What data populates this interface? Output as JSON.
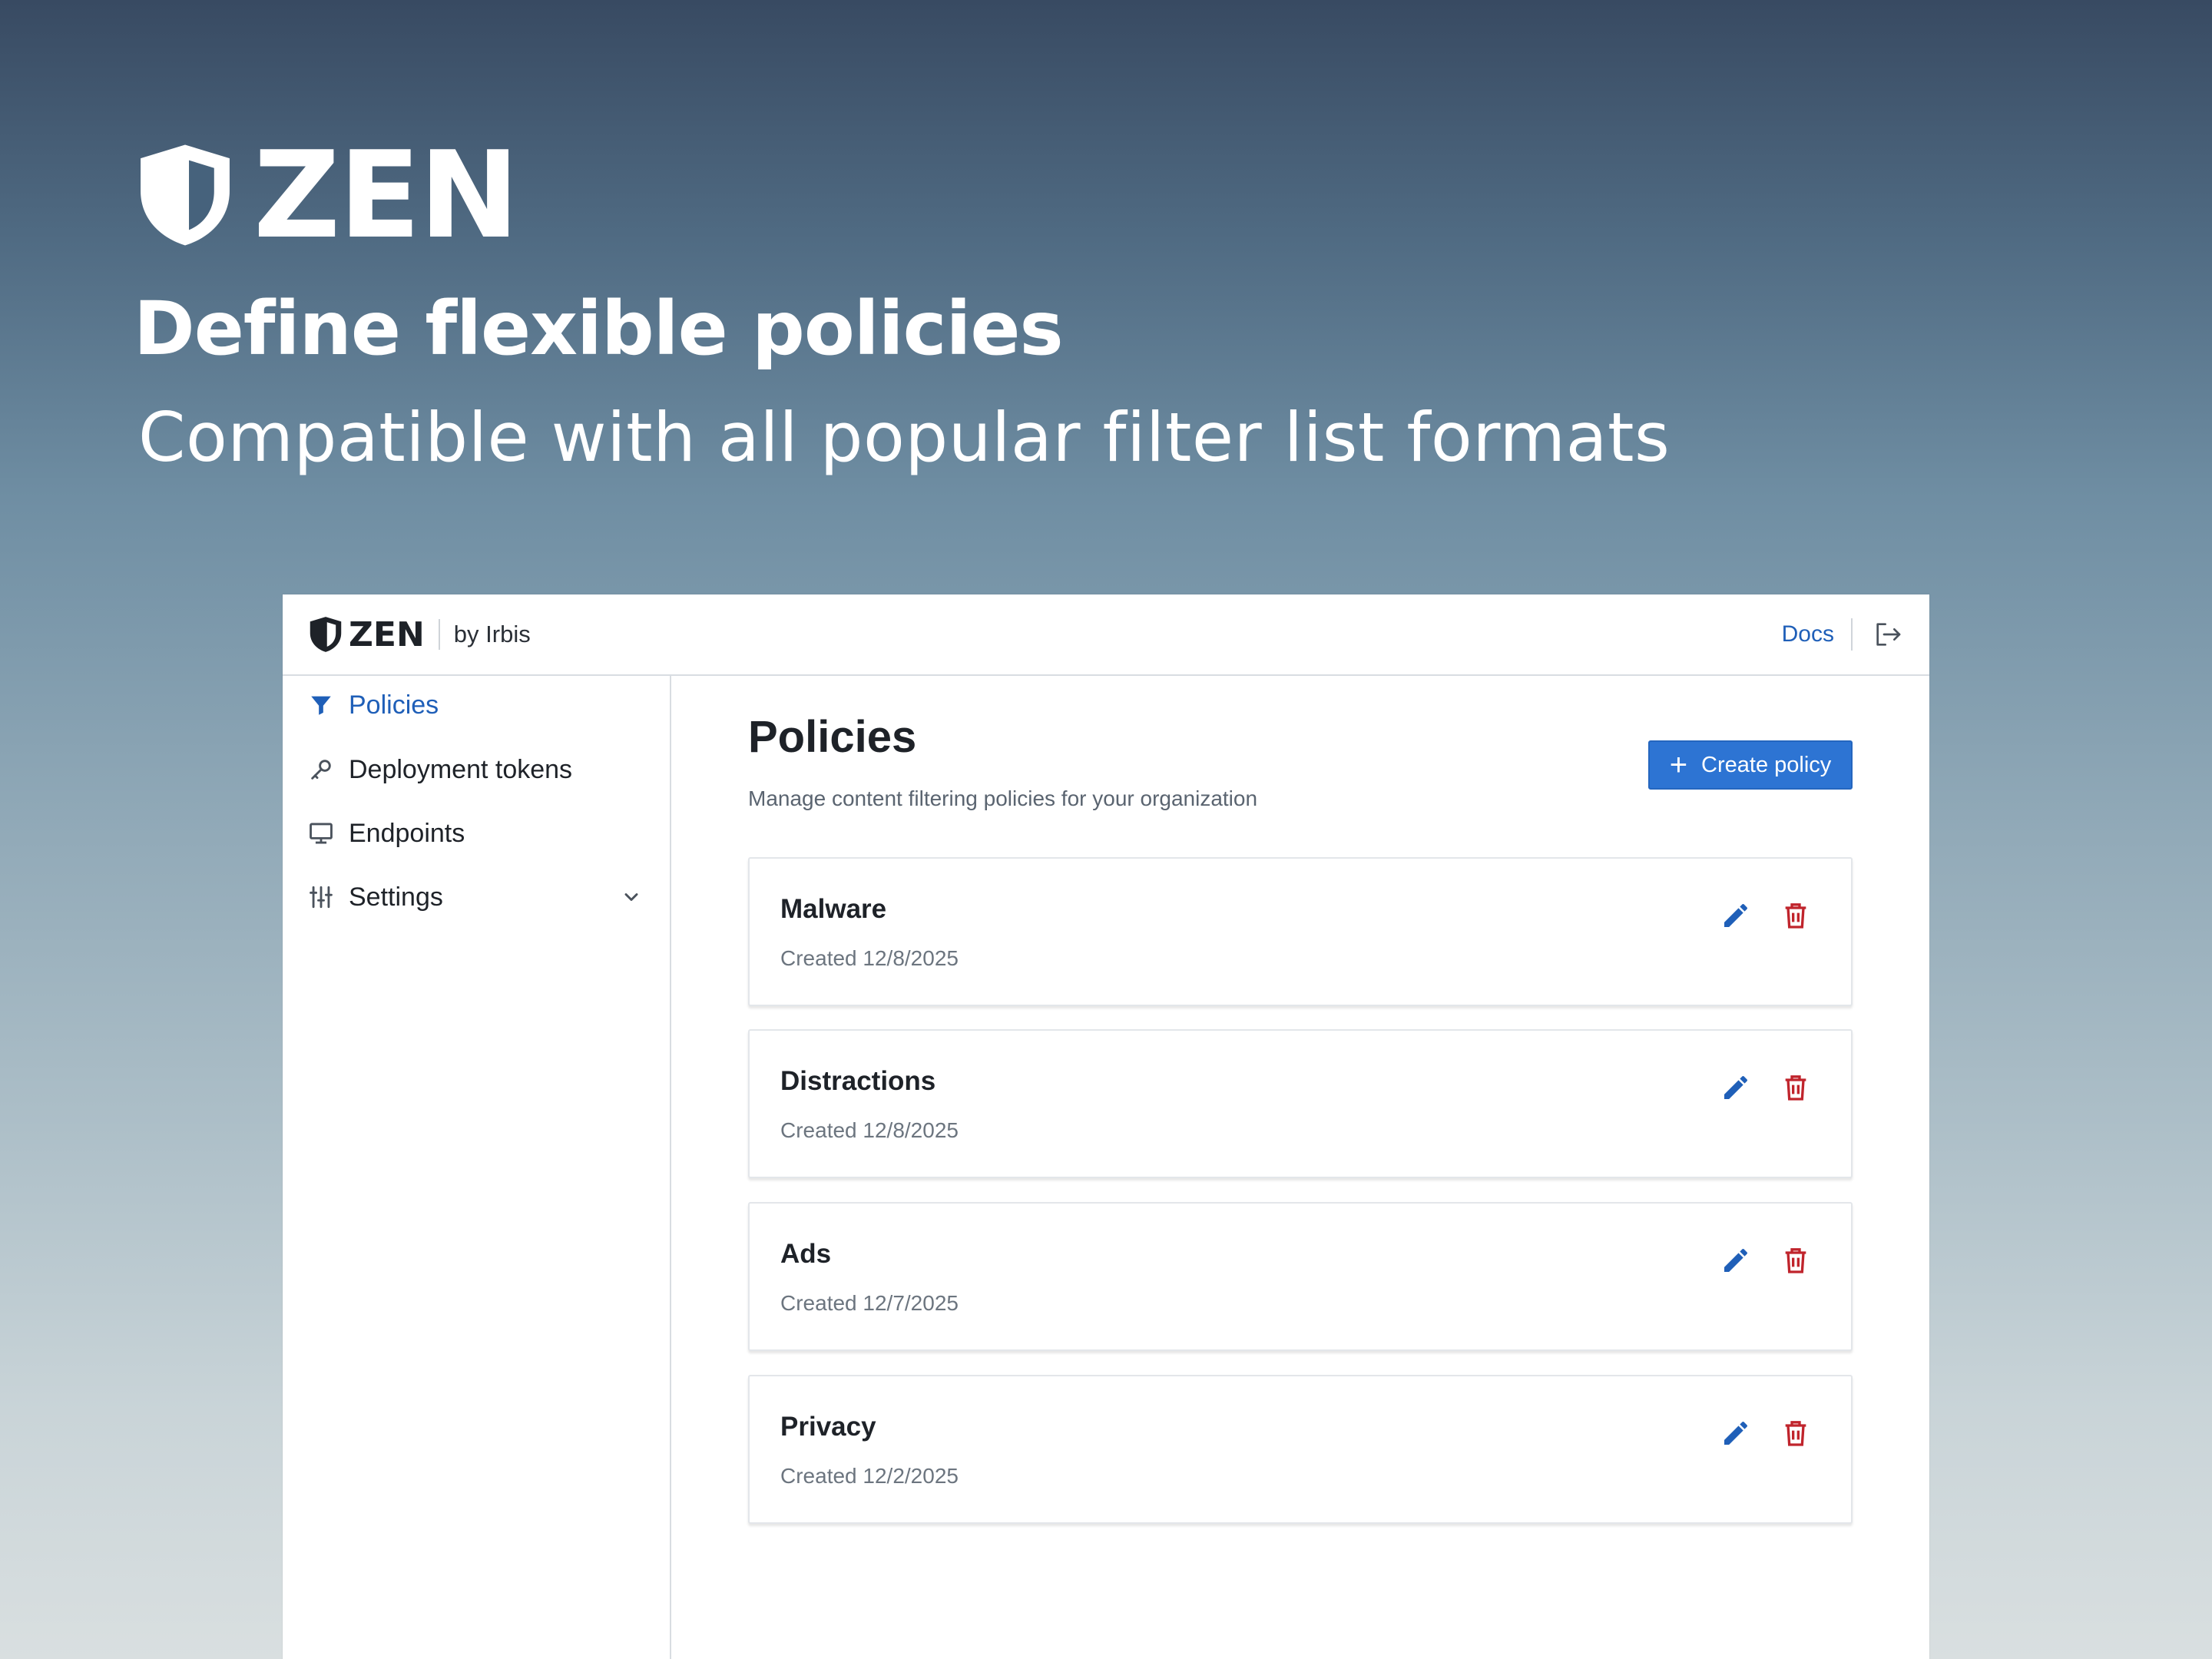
{
  "hero": {
    "logo_text": "ZEN",
    "title": "Define flexible policies",
    "subtitle": "Compatible with all popular filter list formats"
  },
  "app": {
    "brand": {
      "name": "ZEN",
      "byline": "by Irbis"
    },
    "header": {
      "docs_label": "Docs",
      "logout_icon": "logout-icon"
    },
    "sidebar": {
      "items": [
        {
          "label": "Policies",
          "icon": "filter-icon",
          "active": true
        },
        {
          "label": "Deployment tokens",
          "icon": "key-icon",
          "active": false
        },
        {
          "label": "Endpoints",
          "icon": "monitor-icon",
          "active": false
        },
        {
          "label": "Settings",
          "icon": "sliders-icon",
          "active": false,
          "expandable": true
        }
      ]
    },
    "main": {
      "title": "Policies",
      "description": "Manage content filtering policies for your organization",
      "create_button": "Create policy",
      "policies": [
        {
          "name": "Malware",
          "created": "Created 12/8/2025"
        },
        {
          "name": "Distractions",
          "created": "Created 12/8/2025"
        },
        {
          "name": "Ads",
          "created": "Created 12/7/2025"
        },
        {
          "name": "Privacy",
          "created": "Created 12/2/2025"
        }
      ]
    },
    "colors": {
      "accent": "#1f5fb8",
      "button": "#2d74d3",
      "danger": "#c0242c",
      "text": "#1e2228"
    }
  }
}
